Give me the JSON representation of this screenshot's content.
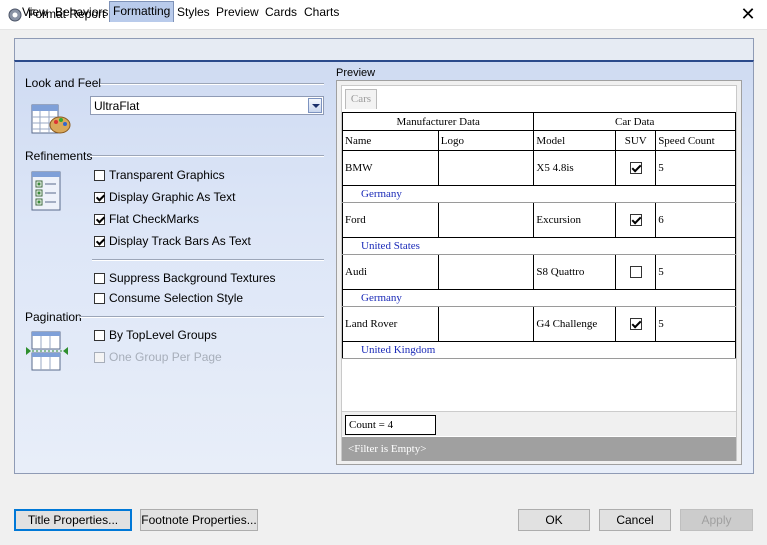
{
  "window": {
    "title": "Format Report",
    "close_glyph": "✕"
  },
  "tabs": [
    {
      "label": "View"
    },
    {
      "label": "Behaviors"
    },
    {
      "label": "Formatting",
      "active": true
    },
    {
      "label": "Styles"
    },
    {
      "label": "Preview"
    },
    {
      "label": "Cards"
    },
    {
      "label": "Charts"
    }
  ],
  "look_and_feel": {
    "section_label": "Look and Feel",
    "style_value": "UltraFlat"
  },
  "refinements": {
    "section_label": "Refinements",
    "options": [
      {
        "label": "Transparent Graphics",
        "checked": false
      },
      {
        "label": "Display Graphic As Text",
        "checked": true
      },
      {
        "label": "Flat CheckMarks",
        "checked": true
      },
      {
        "label": "Display Track Bars As Text",
        "checked": true
      },
      {
        "label": "Suppress Background Textures",
        "checked": false
      },
      {
        "label": "Consume Selection Style",
        "checked": false
      }
    ]
  },
  "pagination": {
    "section_label": "Pagination",
    "options": [
      {
        "label": "By TopLevel Groups",
        "checked": false
      },
      {
        "label": "One Group Per Page",
        "checked": false,
        "disabled": true
      }
    ]
  },
  "preview": {
    "label": "Preview",
    "caption_tab": "Cars",
    "band_headers": [
      "Manufacturer Data",
      "Car Data"
    ],
    "columns": [
      "Name",
      "Logo",
      "Model",
      "SUV",
      "Speed Count"
    ],
    "rows": [
      {
        "name": "BMW",
        "logo": "",
        "model": "X5 4.8is",
        "suv": true,
        "speed_count": "5",
        "country": "Germany"
      },
      {
        "name": "Ford",
        "logo": "",
        "model": "Excursion",
        "suv": true,
        "speed_count": "6",
        "country": "United States"
      },
      {
        "name": "Audi",
        "logo": "",
        "model": "S8 Quattro",
        "suv": false,
        "speed_count": "5",
        "country": "Germany"
      },
      {
        "name": "Land Rover",
        "logo": "",
        "model": "G4 Challenge",
        "suv": true,
        "speed_count": "5",
        "country": "United Kingdom"
      }
    ],
    "footer_count": "Count = 4",
    "filter_text": "<Filter is Empty>"
  },
  "buttons": {
    "title_properties": "Title Properties...",
    "footnote_properties": "Footnote Properties...",
    "ok": "OK",
    "cancel": "Cancel",
    "apply": "Apply"
  },
  "colors": {
    "panel_top": "#cfdbf2",
    "panel_accent": "#2b4a8b",
    "child_row_text": "#1b2bb8",
    "focus_border": "#0078d7"
  },
  "icons": {
    "window": "gear-icon",
    "look_and_feel": "palette-grid-icon",
    "refinements": "checklist-icon",
    "pagination": "page-split-icon"
  }
}
